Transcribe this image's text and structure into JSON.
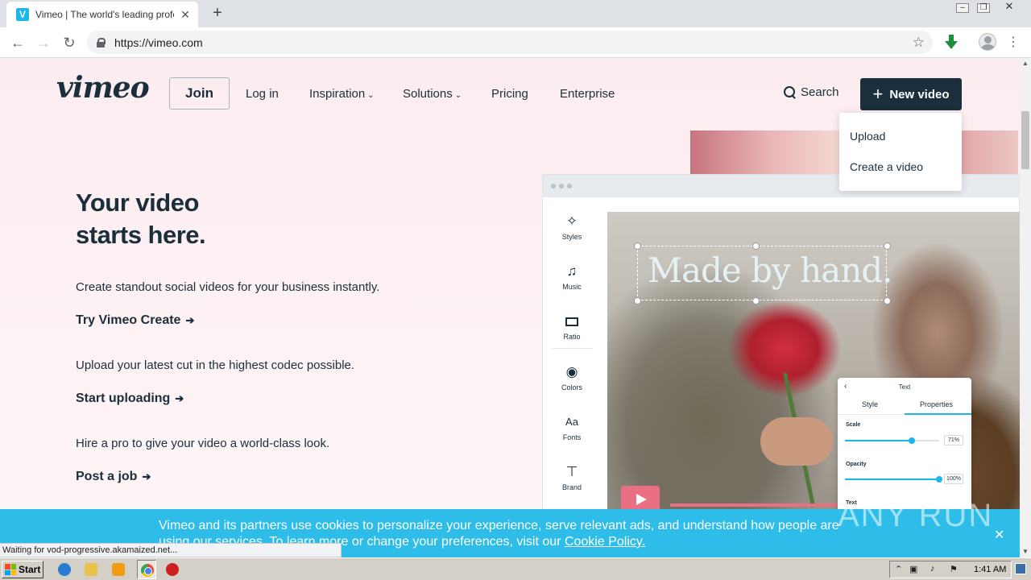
{
  "browser": {
    "tab_title": "Vimeo | The world's leading professio",
    "tab_favicon": "V",
    "url": "https://vimeo.com",
    "status_text": "Waiting for vod-progressive.akamaized.net..."
  },
  "nav": {
    "logo": "vimeo",
    "join": "Join",
    "login": "Log in",
    "inspiration": "Inspiration",
    "solutions": "Solutions",
    "pricing": "Pricing",
    "enterprise": "Enterprise",
    "search": "Search",
    "new_video": "New video"
  },
  "new_video_menu": {
    "items": [
      "Upload",
      "Create a video"
    ]
  },
  "hero": {
    "title_line1": "Your video",
    "title_line2": "starts here.",
    "blocks": [
      {
        "desc": "Create standout social videos for your business instantly.",
        "cta": "Try Vimeo Create"
      },
      {
        "desc": "Upload your latest cut in the highest codec possible.",
        "cta": "Start uploading"
      },
      {
        "desc": "Hire a pro to give your video a world-class look.",
        "cta": "Post a job"
      }
    ]
  },
  "editor_mock": {
    "tools": [
      "Styles",
      "Music",
      "Ratio",
      "Colors",
      "Fonts",
      "Brand"
    ],
    "overlay_text": "Made by hand.",
    "panel": {
      "title": "Text",
      "tabs": [
        "Style",
        "Properties"
      ],
      "active_tab": "Properties",
      "scale_label": "Scale",
      "scale_value": "71%",
      "scale_fraction": 0.71,
      "opacity_label": "Opacity",
      "opacity_value": "100%",
      "opacity_fraction": 1.0,
      "text_label": "Text"
    }
  },
  "cookie": {
    "text": "Vimeo and its partners use cookies to personalize your experience, serve relevant ads, and understand how people are using our services. To learn more or change your preferences, visit our ",
    "link": "Cookie Policy."
  },
  "watermark": "ANY RUN",
  "taskbar": {
    "start": "Start",
    "clock": "1:41 AM"
  },
  "colors": {
    "brand_dark": "#1a2e3b",
    "vimeo_blue": "#1ab7ea",
    "cookie_bg": "#2dbde8",
    "play_pink": "#ea6f82"
  }
}
